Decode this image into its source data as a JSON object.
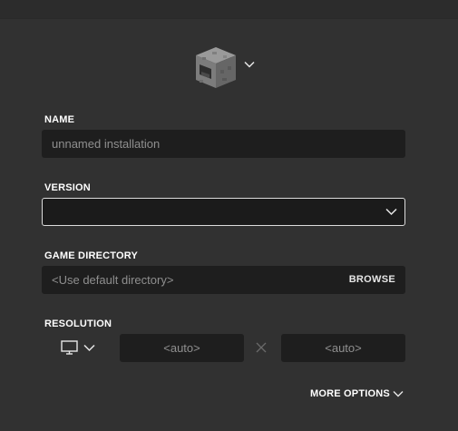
{
  "icon": {
    "name": "furnace-block-icon",
    "colors": {
      "stone": "#8b8b8b",
      "dark": "#3c3c3c",
      "fire": "#6b6b6b"
    }
  },
  "name_field": {
    "label": "NAME",
    "placeholder": "unnamed installation",
    "value": ""
  },
  "version_field": {
    "label": "VERSION",
    "selected": ""
  },
  "directory_field": {
    "label": "GAME DIRECTORY",
    "placeholder": "<Use default directory>",
    "browse_label": "BROWSE"
  },
  "resolution": {
    "label": "RESOLUTION",
    "width_placeholder": "<auto>",
    "height_placeholder": "<auto>"
  },
  "more_options_label": "MORE OPTIONS",
  "colors": {
    "background": "#313131",
    "field": "#1e1e1e",
    "focus_border": "#dcdcdc"
  }
}
